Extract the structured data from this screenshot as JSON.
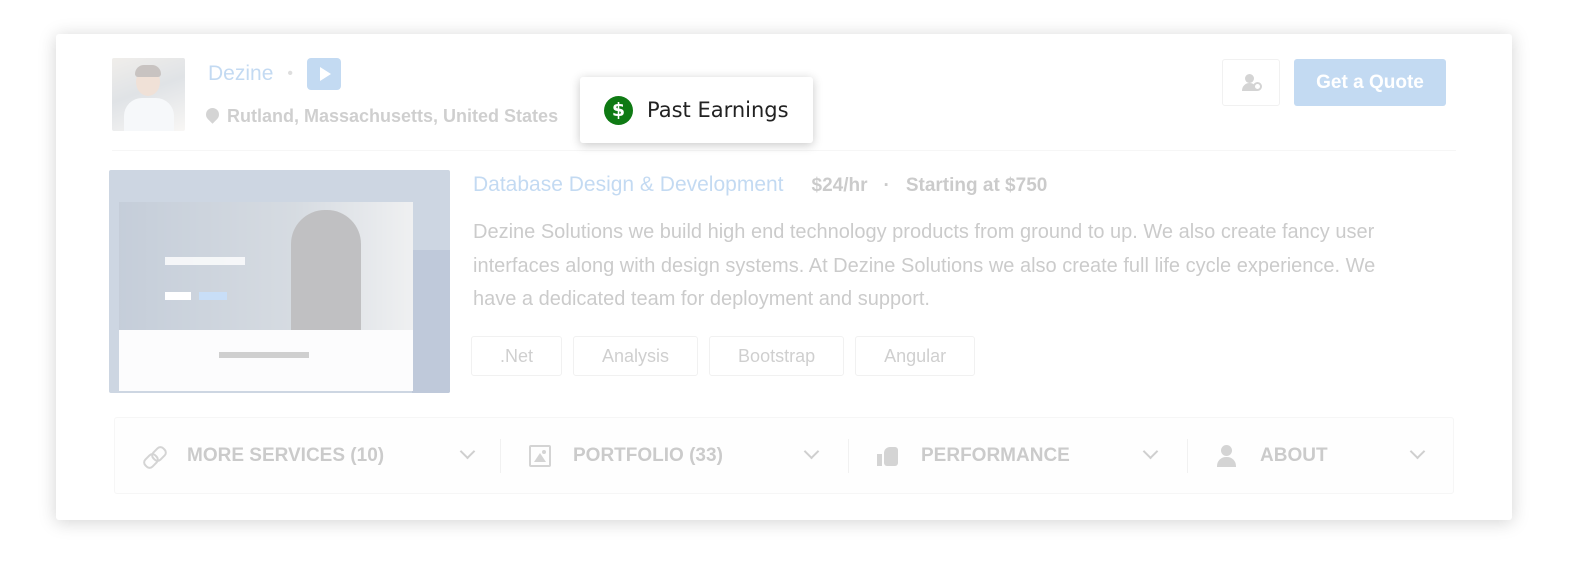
{
  "profile": {
    "name": "Dezine",
    "separator": "•",
    "location": "Rutland, Massachusetts, United States"
  },
  "actions": {
    "follow_icon": "user-plus-icon",
    "quote_label": "Get a Quote"
  },
  "service": {
    "title": "Database Design & Development",
    "rate": "$24/hr",
    "separator": "·",
    "starting": "Starting at $750",
    "description": "Dezine Solutions we build high end technology products from ground to up.  We also create fancy user interfaces along with design systems. At Dezine Solutions we also create full life cycle experience. We have a dedicated team for deployment and support.",
    "tags": [
      ".Net",
      "Analysis",
      "Bootstrap",
      "Angular"
    ]
  },
  "tabs": [
    {
      "label": "MORE SERVICES (10)",
      "icon": "link-icon"
    },
    {
      "label": "PORTFOLIO (33)",
      "icon": "image-icon"
    },
    {
      "label": "PERFORMANCE",
      "icon": "thumbs-up-icon"
    },
    {
      "label": "ABOUT",
      "icon": "user-icon"
    }
  ],
  "tooltip": {
    "icon": "dollar-icon",
    "symbol": "$",
    "label": "Past Earnings",
    "icon_color": "#0f7a14"
  },
  "colors": {
    "accent": "#2a7ad1"
  }
}
